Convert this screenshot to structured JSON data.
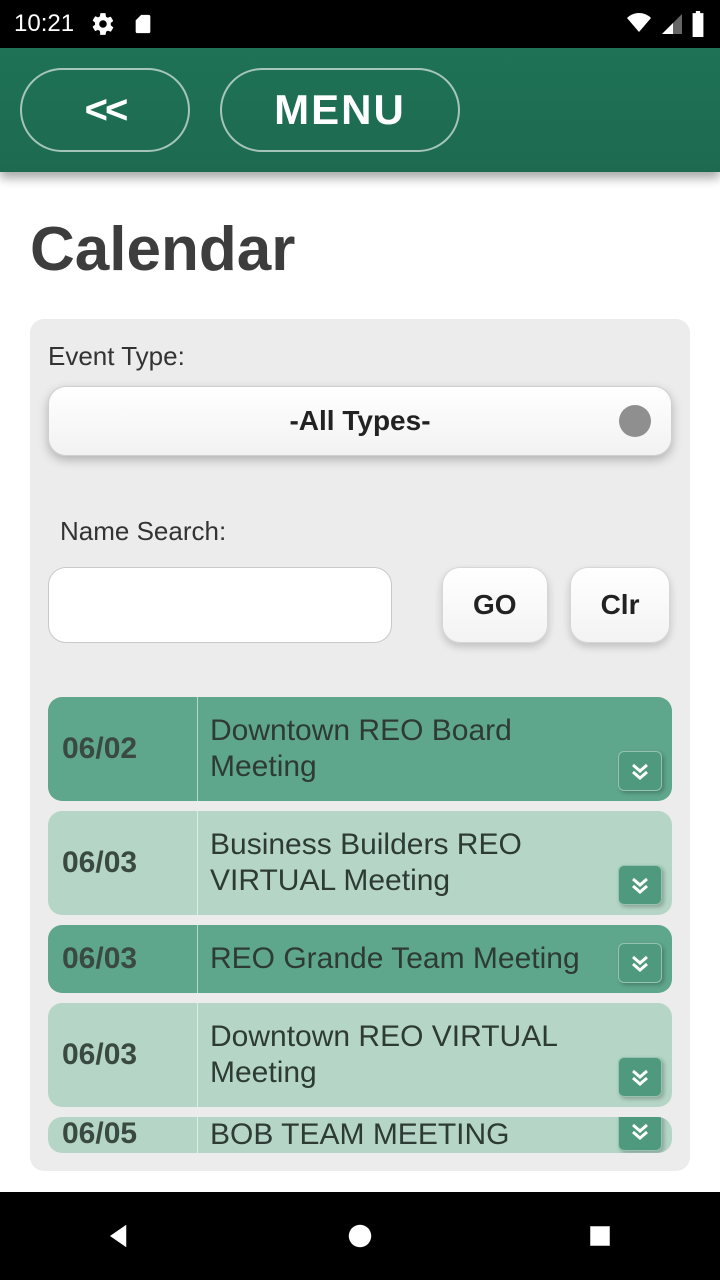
{
  "status": {
    "time": "10:21"
  },
  "header": {
    "back_symbol": "<<",
    "menu_label": "MENU"
  },
  "page": {
    "title": "Calendar"
  },
  "filter": {
    "type_label": "Event Type:",
    "type_selected": "-All Types-",
    "search_label": "Name Search:",
    "go_label": "GO",
    "clr_label": "Clr"
  },
  "events": [
    {
      "date": "06/02",
      "title": "Downtown REO Board Meeting",
      "shade": "dark"
    },
    {
      "date": "06/03",
      "title": "Business Builders REO VIRTUAL Meeting",
      "shade": "light"
    },
    {
      "date": "06/03",
      "title": "REO Grande Team Meeting",
      "shade": "dark"
    },
    {
      "date": "06/03",
      "title": "Downtown REO VIRTUAL Meeting",
      "shade": "light"
    },
    {
      "date": "06/05",
      "title": "BOB TEAM MEETING",
      "shade": "light",
      "partial": true
    }
  ]
}
